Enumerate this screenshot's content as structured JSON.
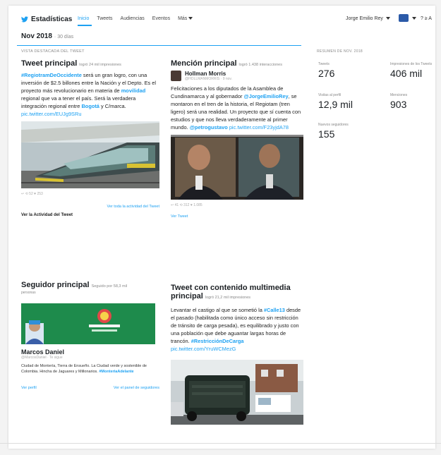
{
  "app": {
    "brand": "Estadísticas",
    "nav": [
      "Inicio",
      "Tweets",
      "Audiencias",
      "Eventos",
      "Más"
    ],
    "user": "Jorge Emilio Rey",
    "lang": "? ≥ A"
  },
  "period": {
    "label": "Nov 2018",
    "days": "· 30 días"
  },
  "section_label": "VISTA DESTACADA DEL TWEET",
  "top_tweet": {
    "title": "Tweet principal",
    "subtitle": "logró 24 mil impresiones",
    "text_hl1": "#RegiotramDeOccidente",
    "text_a": "será un gran logro, con una inversión de $2.5 billones entre la Nación y el Depto. Es el proyecto más revolucionario en materia de",
    "text_hl2": "movilidad",
    "text_b": "regional que va a tener el país. Será la verdadera integración regional entre",
    "text_hl3": "Bogotá",
    "text_c": "y C/marca.",
    "link": "pic.twitter.com/EUJg9SRu",
    "stats": "↩ ⟲ 52 ♥ 253",
    "more_link": "Ver toda la actividad del Tweet",
    "all_activity": "Ver la Actividad del Tweet"
  },
  "top_mention": {
    "title": "Mención principal",
    "subtitle": "logró 1.438 interacciones",
    "author_name": "Hollman Morris",
    "author_handle": "@HOLLMANMORRIS · 9 nov.",
    "text_a": "Felicitaciones a los diputados de la Asamblea de Cundinamarca y al gobernador",
    "text_hl1": "@JorgeEmilioRey",
    "text_b": ", se montaron en el tren de la historia, el Regiotam (tren ligero) será una realidad. Un proyecto que sí cuenta con estudios y que nos lleva verdaderamente al primer mundo.",
    "text_hl2": "@petrogustavo",
    "link": "pic.twitter.com/F23yjdA78",
    "stats": "↩ 41 ⟲ 312 ♥ 1.085",
    "view_link": "Ver Tweet"
  },
  "summary": {
    "heading": "RESUMEN DE NOV. 2018",
    "items": [
      {
        "label": "Tweets",
        "value": "276"
      },
      {
        "label": "Impresiones de los Tweets",
        "value": "406 mil"
      },
      {
        "label": "Visitas al perfil",
        "value": "12,9 mil"
      },
      {
        "label": "Menciones",
        "value": "903"
      },
      {
        "label": "Nuevos seguidores",
        "value": "155"
      }
    ]
  },
  "top_follower": {
    "title": "Seguidor principal",
    "subtitle": "Seguido por 58,3 mil",
    "sub2": "personas",
    "name": "Marcos Daniel",
    "handle": "@MarcosDaniel · Te sigue",
    "bio_a": "Ciudad de Montería, Tierra de Ensueño. La Ciudad verde y sostenible de Colombia. Hincha de Jaguares y Millonarios.",
    "bio_hl": "#MonteriaAdelante",
    "profile_link": "Ver perfil",
    "panel_link": "Ver el panel de seguidores"
  },
  "top_media": {
    "title": "Tweet con contenido multimedia principal",
    "subtitle": "logró 21,2 mil impresiones",
    "text_a": "Levantar el castigo al que se sometió la",
    "text_hl1": "#Calle13",
    "text_b": "desde el pasado (habilitada como único acceso sin restricción de tránsito de carga pesada), es equilibrado y justo con una población que debe aguantar largas horas de trancón.",
    "text_hl2": "#RestricciónDeCarga",
    "link": "pic.twitter.com/YruWCMezG"
  },
  "colors": {
    "accent": "#1da1f2",
    "text": "#1b1f23",
    "muted": "#888888"
  }
}
